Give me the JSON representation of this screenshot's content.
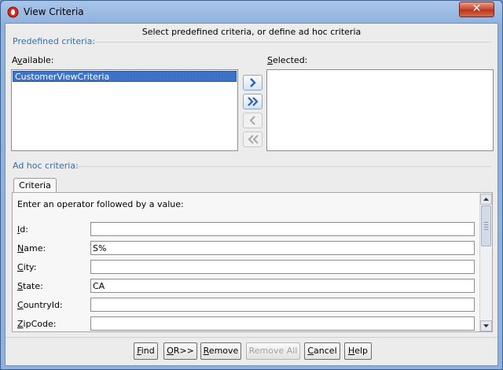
{
  "window": {
    "title": "View Criteria",
    "close_glyph": "✕"
  },
  "instruction": "Select predefined criteria, or define ad hoc criteria",
  "predefined": {
    "group_label": "Predefined criteria:",
    "available_label_pre": "A",
    "available_label_ul": "v",
    "available_label_post": "ailable:",
    "selected_label_ul": "S",
    "selected_label_post": "elected:",
    "available_items": [
      "CustomerViewCriteria"
    ],
    "selected_items": []
  },
  "shuttle": {
    "move": "move-right-icon",
    "move_all": "move-all-right-icon",
    "remove": "move-left-icon",
    "remove_all": "move-all-left-icon"
  },
  "adhoc": {
    "group_label": "Ad hoc criteria:",
    "tab_label": "Criteria",
    "hint": "Enter an operator followed by a value:",
    "fields": [
      {
        "ul": "I",
        "rest": "d:",
        "value": ""
      },
      {
        "ul": "N",
        "rest": "ame:",
        "value": "S%"
      },
      {
        "ul": "C",
        "rest": "ity:",
        "value": ""
      },
      {
        "ul": "S",
        "rest": "tate:",
        "value": "CA"
      },
      {
        "ul": "C",
        "rest": "ountryId:",
        "value": ""
      },
      {
        "ul": "Z",
        "rest": "ipCode:",
        "value": ""
      }
    ]
  },
  "buttons": {
    "find_ul": "F",
    "find_rest": "ind",
    "or_ul": "O",
    "or_rest": "R>>",
    "remove_ul": "R",
    "remove_rest": "emove",
    "remove_all": "Remove All",
    "cancel_ul": "C",
    "cancel_rest": "ancel",
    "help_ul": "H",
    "help_rest": "elp"
  },
  "colors": {
    "selection": "#3d72c6",
    "group_label": "#3a6ea5",
    "close": "#c8452d"
  }
}
